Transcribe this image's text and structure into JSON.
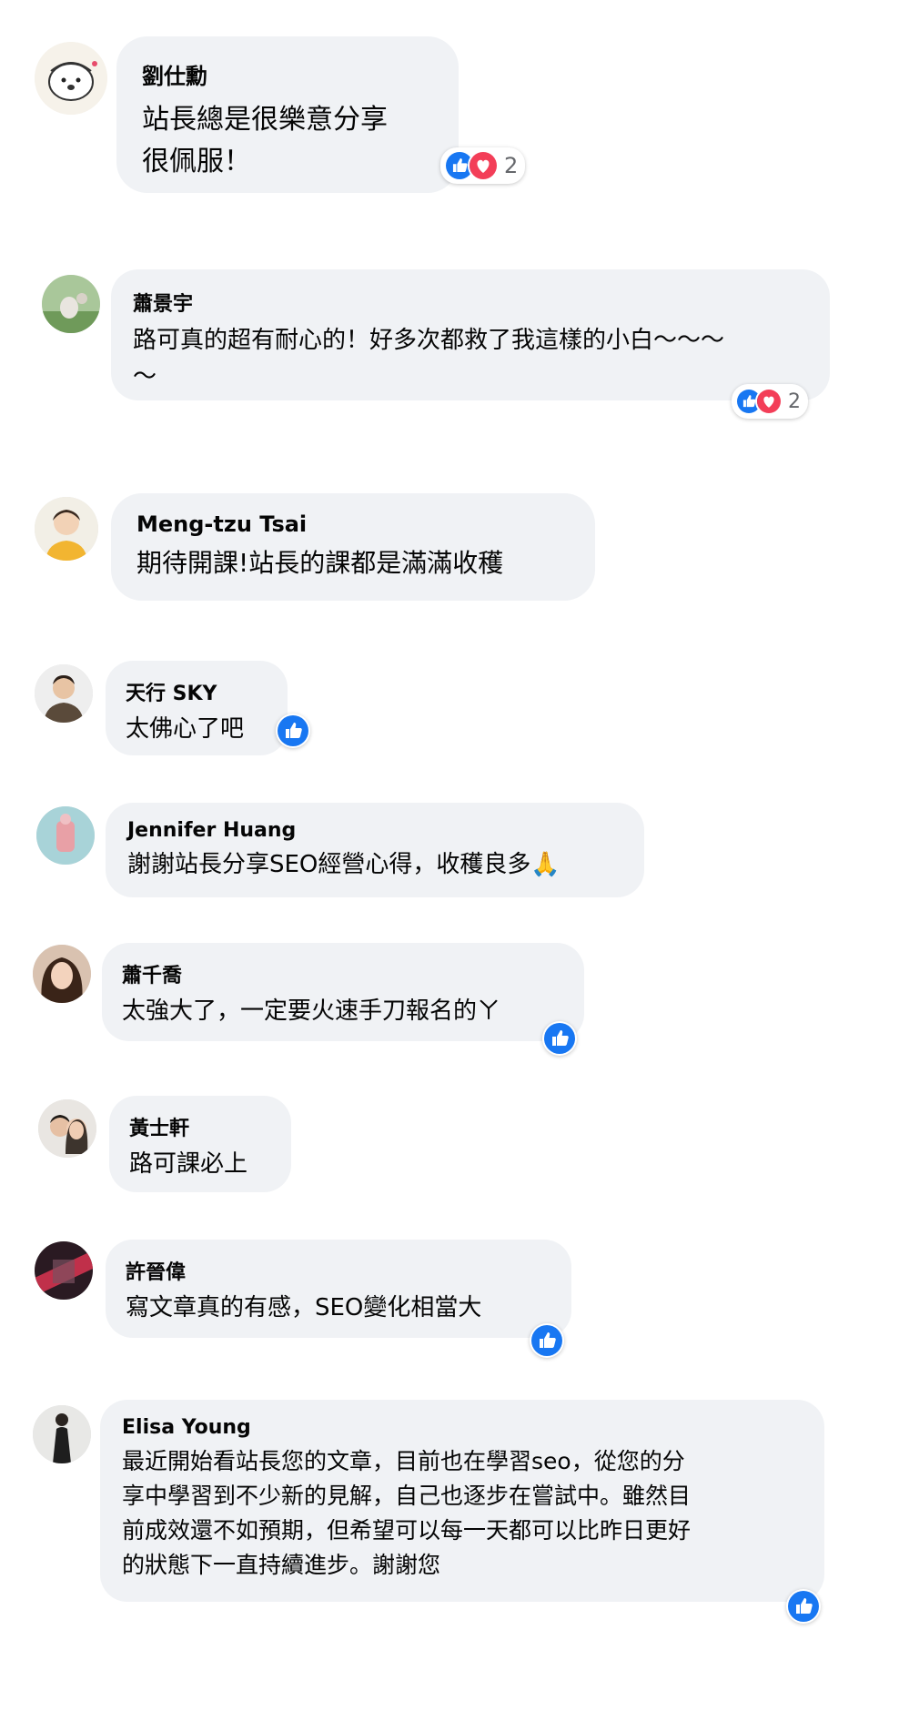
{
  "colors": {
    "bubble": "#f0f2f5",
    "like": "#1877f2",
    "love": "#f33e58",
    "count": "#65676b"
  },
  "comments": [
    {
      "name": "劉仕勳",
      "lines": "站長總是很樂意分享\n很佩服！",
      "reactions": [
        "like-icon",
        "love-icon"
      ],
      "count": "2"
    },
    {
      "name": "蕭景宇",
      "lines": "路可真的超有耐心的！好多次都救了我這樣的小白～～～\n～",
      "reactions": [
        "like-icon",
        "love-icon"
      ],
      "count": "2"
    },
    {
      "name": "Meng-tzu Tsai",
      "lines": "期待開課!站長的課都是滿滿收穫",
      "reactions": [],
      "count": ""
    },
    {
      "name": "天行 SKY",
      "lines": "太佛心了吧",
      "reactions": [
        "like-icon"
      ],
      "count": ""
    },
    {
      "name": "Jennifer Huang",
      "lines": "謝謝站長分享SEO經營心得，收穫良多🙏",
      "reactions": [],
      "count": ""
    },
    {
      "name": "蕭千喬",
      "lines": "太強大了，一定要火速手刀報名的ㄚ",
      "reactions": [
        "like-icon"
      ],
      "count": ""
    },
    {
      "name": "黃士軒",
      "lines": "路可課必上",
      "reactions": [],
      "count": ""
    },
    {
      "name": "許晉偉",
      "lines": "寫文章真的有感，SEO變化相當大",
      "reactions": [
        "like-icon"
      ],
      "count": ""
    },
    {
      "name": "Elisa Young",
      "lines": "最近開始看站長您的文章，目前也在學習seo，從您的分\n享中學習到不少新的見解，自己也逐步在嘗試中。雖然目\n前成效還不如預期，但希望可以每一天都可以比昨日更好\n的狀態下一直持續進步。謝謝您",
      "reactions": [
        "like-icon"
      ],
      "count": ""
    }
  ]
}
